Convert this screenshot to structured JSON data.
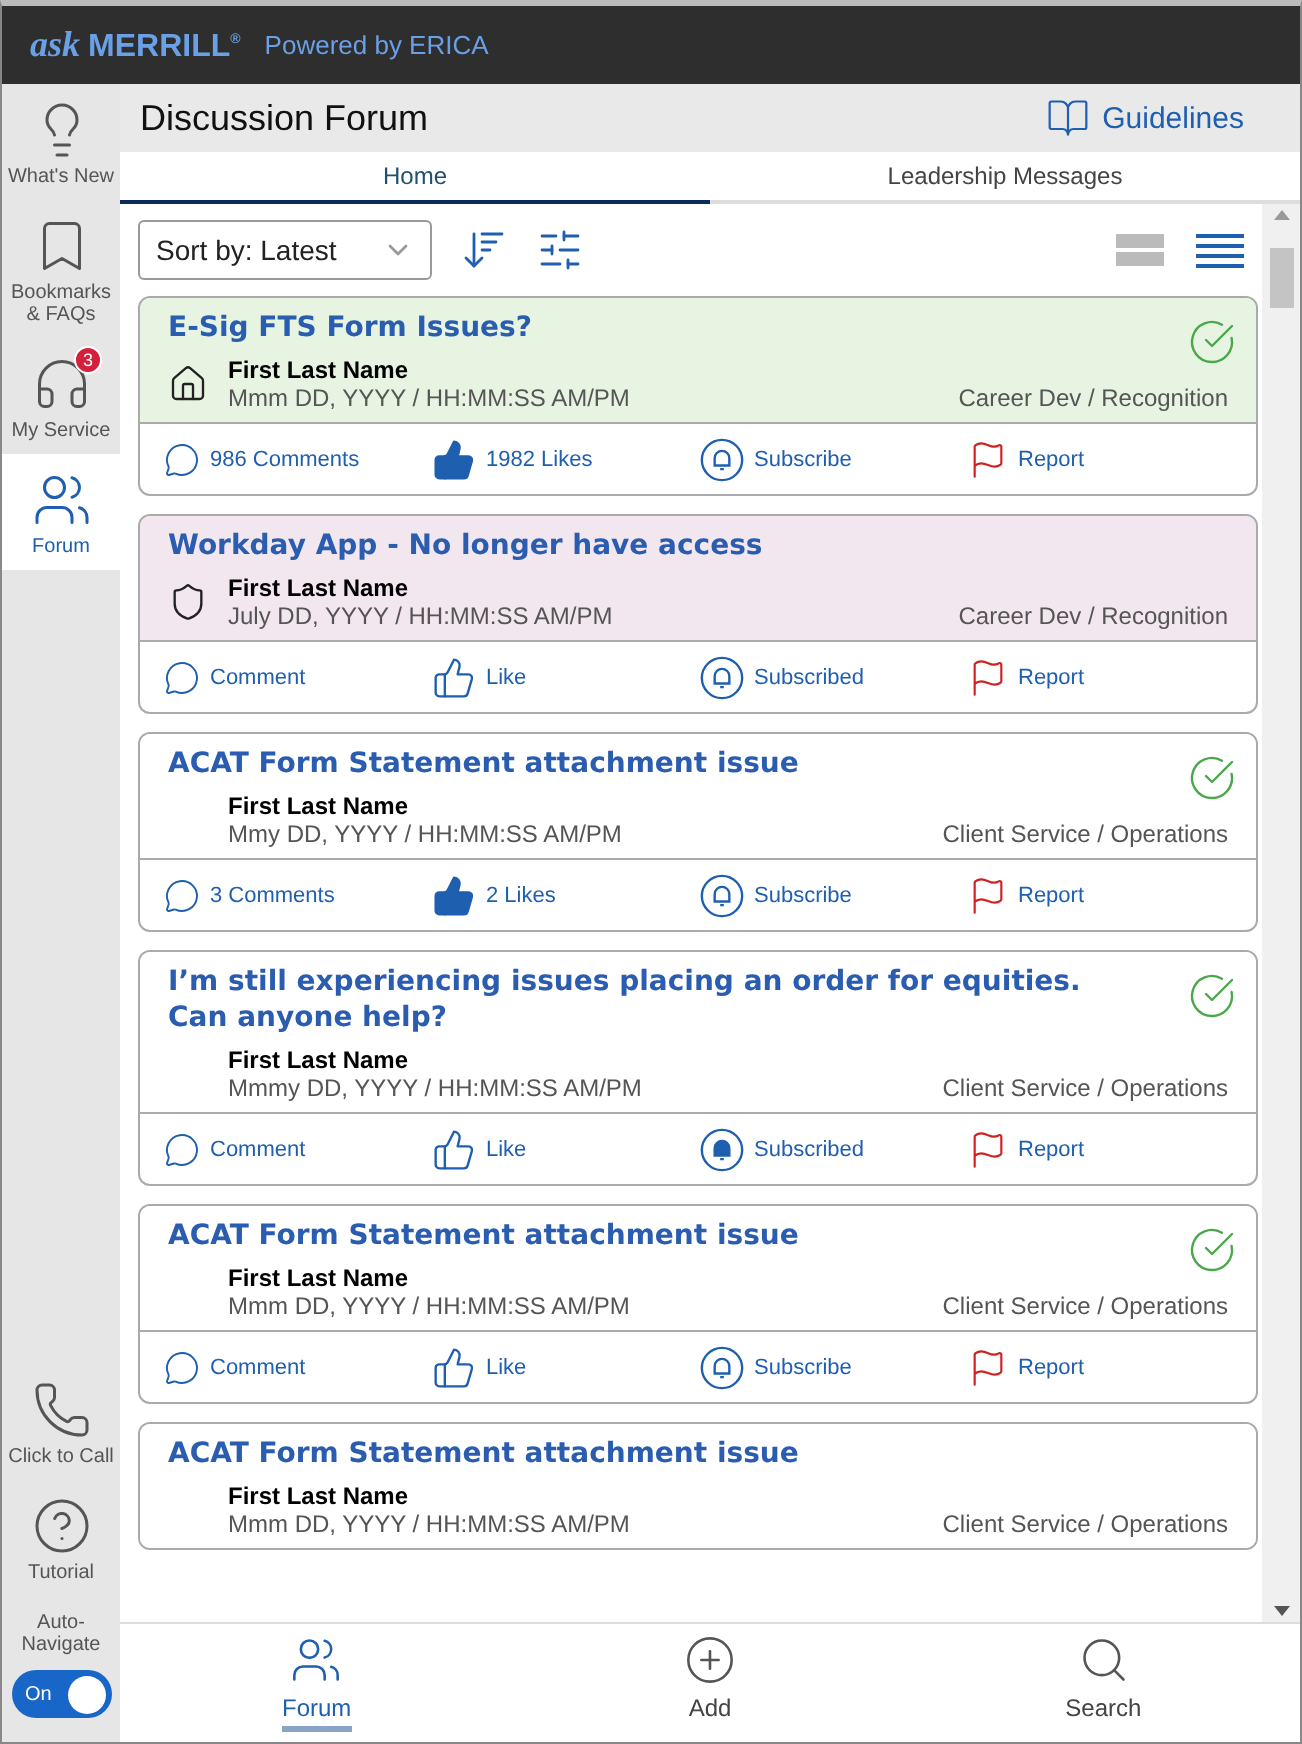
{
  "brand": {
    "logo_prefix": "ask",
    "logo_name": "MERRILL",
    "logo_mark": "®",
    "tagline": "Powered by ERICA"
  },
  "sidebar": {
    "items": [
      {
        "kind": "bulb",
        "label": "What's New",
        "selected": false
      },
      {
        "kind": "bookmark",
        "label": "Bookmarks & FAQs",
        "selected": false
      },
      {
        "kind": "headset",
        "label": "My Service",
        "selected": false,
        "badge": "3"
      },
      {
        "kind": "people",
        "label": "Forum",
        "selected": true
      }
    ],
    "bottom_items": [
      {
        "kind": "phone",
        "label": "Click to Call"
      },
      {
        "kind": "help",
        "label": "Tutorial"
      }
    ],
    "auto_navigate": {
      "label": "Auto-Navigate",
      "state_label": "On",
      "on": true
    }
  },
  "header": {
    "title": "Discussion Forum",
    "guidelines": "Guidelines"
  },
  "tabs": [
    {
      "label": "Home",
      "selected": true
    },
    {
      "label": "Leadership Messages",
      "selected": false
    }
  ],
  "toolbar": {
    "sort": "Sort by: Latest",
    "view_options": [
      {
        "kind": "cards",
        "selected": false
      },
      {
        "kind": "list",
        "selected": true
      }
    ]
  },
  "posts": [
    {
      "kind": "pinned",
      "title": "E-Sig FTS Form Issues?",
      "author": "First Last Name",
      "date": "Mmm DD, YYYY / HH:MM:SS AM/PM",
      "category": "Career Dev / Recognition",
      "resolved": true,
      "actions": {
        "comments": "986 Comments",
        "liked": true,
        "likes": "1982 Likes",
        "subscribed": false,
        "subscribe": "Subscribe",
        "report": "Report"
      }
    },
    {
      "kind": "restricted",
      "title": "Workday App - No longer have access",
      "author": "First Last Name",
      "date": "July DD, YYYY / HH:MM:SS AM/PM",
      "category": "Career Dev / Recognition",
      "resolved": false,
      "actions": {
        "comments": "Comment",
        "liked": false,
        "likes": "Like",
        "subscribed": false,
        "subscribe": "Subscribed",
        "report": "Report"
      }
    },
    {
      "kind": "normal",
      "title": "ACAT Form Statement attachment issue",
      "author": "First Last Name",
      "date": "Mmy DD, YYYY / HH:MM:SS AM/PM",
      "category": "Client Service / Operations",
      "resolved": true,
      "actions": {
        "comments": "3 Comments",
        "liked": true,
        "likes": "2 Likes",
        "subscribed": false,
        "subscribe": "Subscribe",
        "report": "Report"
      }
    },
    {
      "kind": "normal",
      "title": "I’m still experiencing issues placing an order for equities. Can anyone help?",
      "author": "First Last Name",
      "date": "Mmmy DD, YYYY / HH:MM:SS AM/PM",
      "category": "Client Service / Operations",
      "resolved": true,
      "actions": {
        "comments": "Comment",
        "liked": false,
        "likes": "Like",
        "subscribed": true,
        "subscribe": "Subscribed",
        "report": "Report"
      }
    },
    {
      "kind": "normal",
      "title": "ACAT Form Statement attachment issue",
      "author": "First Last Name",
      "date": "Mmm DD, YYYY / HH:MM:SS AM/PM",
      "category": "Client Service / Operations",
      "resolved": true,
      "actions": {
        "comments": "Comment",
        "liked": false,
        "likes": "Like",
        "subscribed": false,
        "subscribe": "Subscribe",
        "report": "Report"
      }
    },
    {
      "kind": "normal",
      "title": "ACAT Form Statement attachment issue",
      "author": "First Last Name",
      "date": "Mmm DD, YYYY / HH:MM:SS AM/PM",
      "category": "Client Service / Operations",
      "resolved": false
    }
  ],
  "bottom_nav": [
    {
      "kind": "people",
      "label": "Forum",
      "selected": true
    },
    {
      "kind": "add",
      "label": "Add",
      "selected": false
    },
    {
      "kind": "search",
      "label": "Search",
      "selected": false
    }
  ]
}
